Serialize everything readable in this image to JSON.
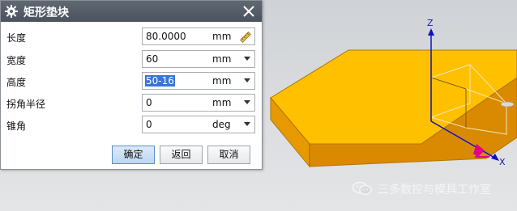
{
  "dialog": {
    "title": "矩形垫块",
    "title_icon": "gear-icon",
    "close_icon": "close-icon",
    "fields": [
      {
        "label": "长度",
        "value": "80.0000",
        "unit": "mm",
        "control": "ruler-icon"
      },
      {
        "label": "宽度",
        "value": "60",
        "unit": "mm",
        "control": "dropdown"
      },
      {
        "label": "高度",
        "value": "50-16",
        "unit": "mm",
        "control": "dropdown",
        "selected": true
      },
      {
        "label": "拐角半径",
        "value": "0",
        "unit": "mm",
        "control": "dropdown"
      },
      {
        "label": "锥角",
        "value": "0",
        "unit": "deg",
        "control": "dropdown"
      }
    ],
    "buttons": {
      "ok": "确定",
      "back": "返回",
      "cancel": "取消"
    }
  },
  "viewport": {
    "axes": {
      "z": "Z",
      "x": "X"
    },
    "block_color": "#ffc000",
    "block_side_color": "#d88a00",
    "axis_color": "#1010c8",
    "marker_color": "#e0008a"
  },
  "watermark": {
    "icon": "wechat-icon",
    "text": "三多数控与模具工作室"
  }
}
